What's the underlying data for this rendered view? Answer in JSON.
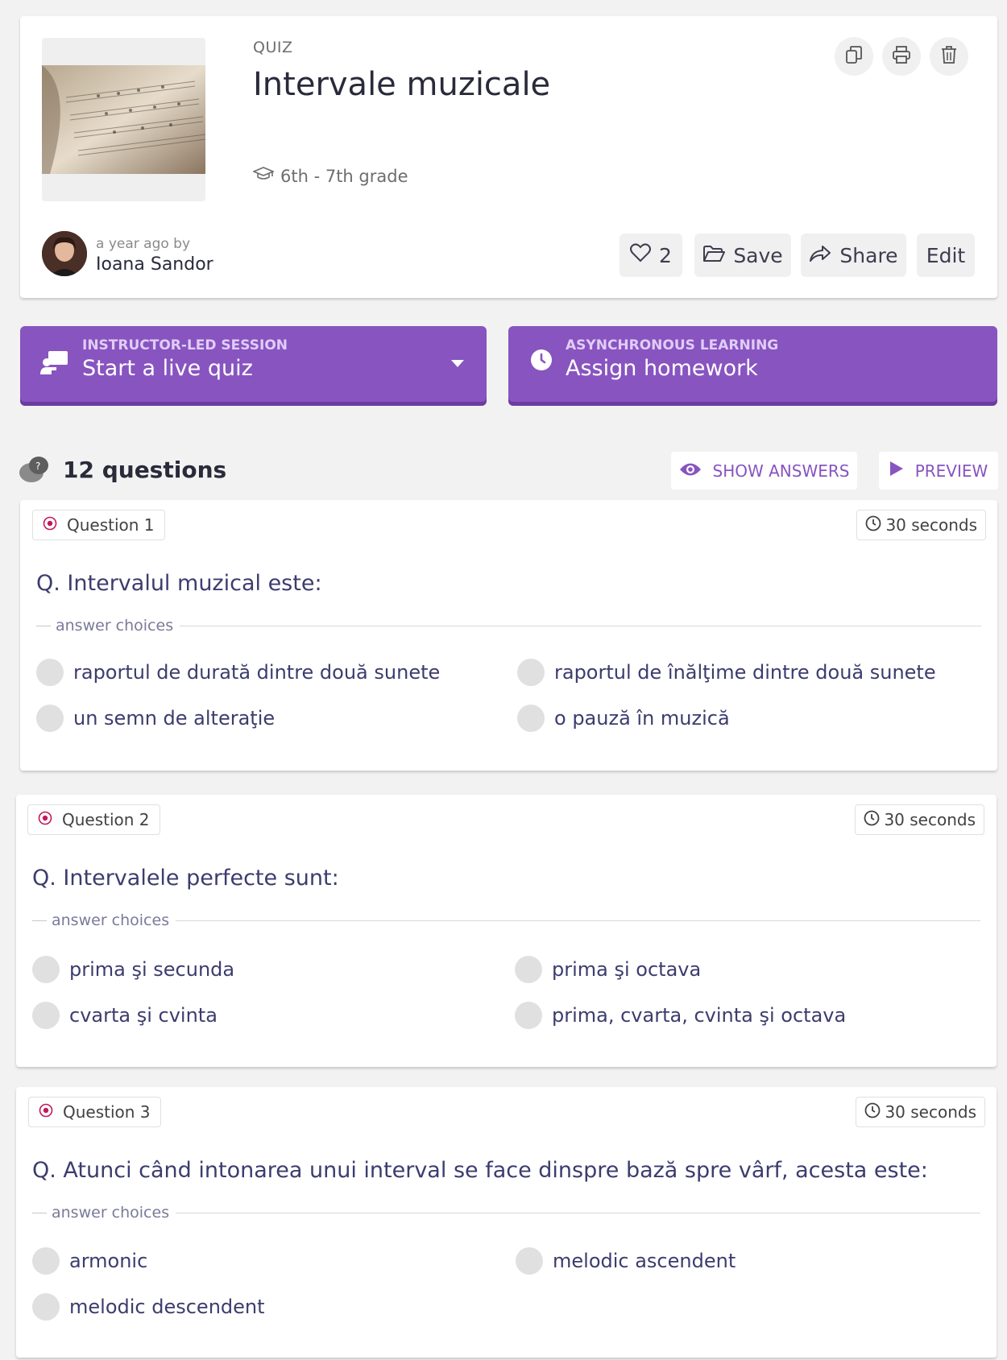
{
  "quiz": {
    "type_label": "QUIZ",
    "title": "Intervale muzicale",
    "grade": "6th - 7th grade",
    "time_ago": "a year ago by",
    "author": "Ioana Sandor",
    "likes": "2",
    "save_label": "Save",
    "share_label": "Share",
    "edit_label": "Edit"
  },
  "actions": {
    "live": {
      "kicker": "INSTRUCTOR-LED SESSION",
      "label": "Start a live quiz"
    },
    "homework": {
      "kicker": "ASYNCHRONOUS LEARNING",
      "label": "Assign homework"
    }
  },
  "questions_bar": {
    "count_label": "12 questions",
    "show_answers_label": "SHOW ANSWERS",
    "preview_label": "PREVIEW"
  },
  "answer_choices_label": "answer choices",
  "questions": [
    {
      "tag": "Question 1",
      "time": "30 seconds",
      "text": "Q. Intervalul muzical este:",
      "options": [
        "raportul de durată dintre două sunete",
        "raportul de înălţime dintre două sunete",
        "un semn de alteraţie",
        "o pauză în muzică"
      ]
    },
    {
      "tag": "Question 2",
      "time": "30 seconds",
      "text": "Q. Intervalele perfecte sunt:",
      "options": [
        "prima şi secunda",
        "prima şi octava",
        "cvarta şi cvinta",
        "prima, cvarta, cvinta şi octava"
      ]
    },
    {
      "tag": "Question 3",
      "time": "30 seconds",
      "text": "Q. Atunci când intonarea unui interval se face dinspre bază spre vârf, acesta este:",
      "options": [
        "armonic",
        "melodic ascendent",
        "melodic descendent"
      ]
    }
  ],
  "colors": {
    "brand_purple": "#8854c0",
    "purple_shadow": "#6c3da1",
    "question_text": "#3c3c6e",
    "tag_icon_red": "#c2185b"
  }
}
